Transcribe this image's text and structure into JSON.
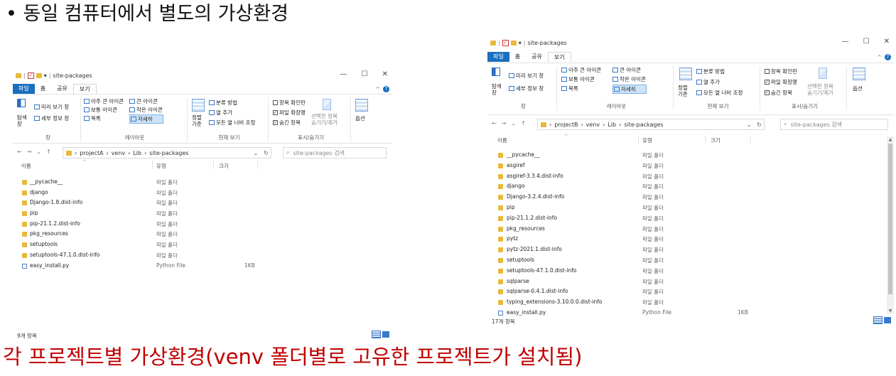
{
  "heading": "• 동일 컴퓨터에서 별도의 가상환경",
  "caption": "각 프로젝트별 가상환경(venv 폴더별로 고유한 프로젝트가 설치됨)",
  "left_window": {
    "title": "site-packages",
    "tabs": [
      "파일",
      "홈",
      "공유",
      "보기"
    ],
    "controls": {
      "minimize": "—",
      "maximize": "☐",
      "close": "✕"
    },
    "ribbon": {
      "nav_pane": "탐색\n창",
      "preview_pane": "미리 보기 창",
      "details_pane": "세부 정보 창",
      "pane_group": "창",
      "layouts": [
        "아주 큰 아이콘",
        "큰 아이콘",
        "보통 아이콘",
        "작은 아이콘",
        "목록",
        "자세히"
      ],
      "layout_group": "레이아웃",
      "sort": "정렬\n기준",
      "group_by": "분류 방법",
      "add_columns": "열 추가",
      "fit_columns": "모든 열 너비 조정",
      "current_view_group": "현재 보기",
      "item_checkboxes": "항목 확인란",
      "file_extensions": "파일 확장명",
      "hidden_items": "숨긴 항목",
      "hide_selected": "선택한 항목\n숨기기/제거",
      "show_hide_group": "표시/숨기기",
      "options": "옵션"
    },
    "breadcrumb": [
      "projectA",
      "venv",
      "Lib",
      "site-packages"
    ],
    "search_placeholder": "site-packages 검색",
    "columns": {
      "name": "이름",
      "type": "유형",
      "size": "크기"
    },
    "files": [
      {
        "name": "__pycache__",
        "type": "파일 폴더",
        "size": "",
        "icon": "folder-icon"
      },
      {
        "name": "django",
        "type": "파일 폴더",
        "size": "",
        "icon": "folder-icon"
      },
      {
        "name": "Django-1.8.dist-info",
        "type": "파일 폴더",
        "size": "",
        "icon": "folder-icon"
      },
      {
        "name": "pip",
        "type": "파일 폴더",
        "size": "",
        "icon": "folder-icon"
      },
      {
        "name": "pip-21.1.2.dist-info",
        "type": "파일 폴더",
        "size": "",
        "icon": "folder-icon"
      },
      {
        "name": "pkg_resources",
        "type": "파일 폴더",
        "size": "",
        "icon": "folder-icon"
      },
      {
        "name": "setuptools",
        "type": "파일 폴더",
        "size": "",
        "icon": "folder-icon"
      },
      {
        "name": "setuptools-47.1.0.dist-info",
        "type": "파일 폴더",
        "size": "",
        "icon": "folder-icon"
      },
      {
        "name": "easy_install.py",
        "type": "Python File",
        "size": "1KB",
        "icon": "python-file-icon"
      }
    ],
    "status": "9개 항목"
  },
  "right_window": {
    "title": "site-packages",
    "tabs": [
      "파일",
      "홈",
      "공유",
      "보기"
    ],
    "controls": {
      "minimize": "—",
      "maximize": "☐",
      "close": "✕"
    },
    "ribbon": {
      "nav_pane": "탐색\n창",
      "preview_pane": "미리 보기 창",
      "details_pane": "세부 정보 창",
      "pane_group": "창",
      "layouts": [
        "아주 큰 아이콘",
        "큰 아이콘",
        "보통 아이콘",
        "작은 아이콘",
        "목록",
        "자세히"
      ],
      "layout_group": "레이아웃",
      "sort": "정렬\n기준",
      "group_by": "분류 방법",
      "add_columns": "열 추가",
      "fit_columns": "모든 열 너비 조정",
      "current_view_group": "현재 보기",
      "item_checkboxes": "항목 확인란",
      "file_extensions": "파일 확장명",
      "hidden_items": "숨긴 항목",
      "hide_selected": "선택한 항목\n숨기기/제거",
      "show_hide_group": "표시/숨기기",
      "options": "옵션"
    },
    "breadcrumb": [
      "projectB",
      "venv",
      "Lib",
      "site-packages"
    ],
    "search_placeholder": "site-packages 검색",
    "columns": {
      "name": "이름",
      "type": "유형",
      "size": "크기"
    },
    "files": [
      {
        "name": "__pycache__",
        "type": "파일 폴더",
        "size": "",
        "icon": "folder-icon"
      },
      {
        "name": "asgiref",
        "type": "파일 폴더",
        "size": "",
        "icon": "folder-icon"
      },
      {
        "name": "asgiref-3.3.4.dist-info",
        "type": "파일 폴더",
        "size": "",
        "icon": "folder-icon"
      },
      {
        "name": "django",
        "type": "파일 폴더",
        "size": "",
        "icon": "folder-icon"
      },
      {
        "name": "Django-3.2.4.dist-info",
        "type": "파일 폴더",
        "size": "",
        "icon": "folder-icon"
      },
      {
        "name": "pip",
        "type": "파일 폴더",
        "size": "",
        "icon": "folder-icon"
      },
      {
        "name": "pip-21.1.2.dist-info",
        "type": "파일 폴더",
        "size": "",
        "icon": "folder-icon"
      },
      {
        "name": "pkg_resources",
        "type": "파일 폴더",
        "size": "",
        "icon": "folder-icon"
      },
      {
        "name": "pytz",
        "type": "파일 폴더",
        "size": "",
        "icon": "folder-icon"
      },
      {
        "name": "pytz-2021.1.dist-info",
        "type": "파일 폴더",
        "size": "",
        "icon": "folder-icon"
      },
      {
        "name": "setuptools",
        "type": "파일 폴더",
        "size": "",
        "icon": "folder-icon"
      },
      {
        "name": "setuptools-47.1.0.dist-info",
        "type": "파일 폴더",
        "size": "",
        "icon": "folder-icon"
      },
      {
        "name": "sqlparse",
        "type": "파일 폴더",
        "size": "",
        "icon": "folder-icon"
      },
      {
        "name": "sqlparse-0.4.1.dist-info",
        "type": "파일 폴더",
        "size": "",
        "icon": "folder-icon"
      },
      {
        "name": "typing_extensions-3.10.0.0.dist-info",
        "type": "파일 폴더",
        "size": "",
        "icon": "folder-icon"
      },
      {
        "name": "easy_install.py",
        "type": "Python File",
        "size": "1KB",
        "icon": "python-file-icon"
      }
    ],
    "status": "17개 항목"
  },
  "colors": {
    "accent": "#1a6fc0",
    "caption": "#c00000",
    "folder": "#e8b93a"
  }
}
